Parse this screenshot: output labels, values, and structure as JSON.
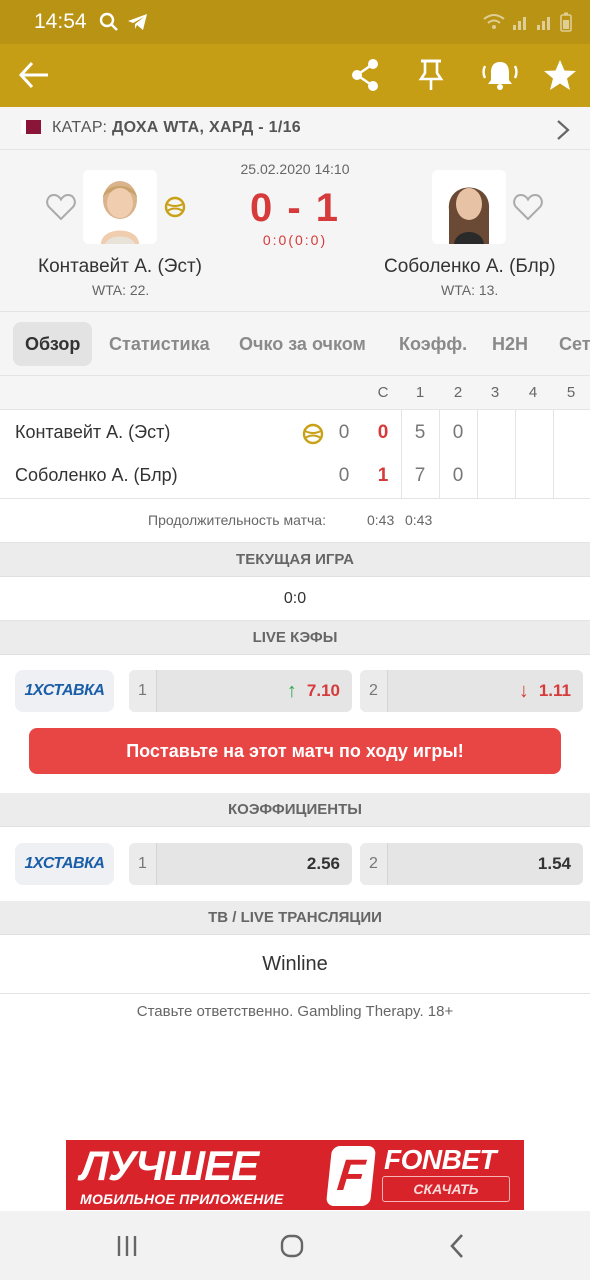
{
  "status_bar": {
    "time": "14:54"
  },
  "tournament": {
    "prefix": "КАТАР:",
    "name": "ДОХА WTA, ХАРД - 1/16"
  },
  "match": {
    "datetime": "25.02.2020 14:10",
    "score": "0 - 1",
    "subscore": "0:0(0:0)",
    "player1": {
      "name": "Контавейт А. (Эст)",
      "rank": "WTA: 22."
    },
    "player2": {
      "name": "Соболенко А. (Блр)",
      "rank": "WTA: 13."
    }
  },
  "tabs": [
    "Обзор",
    "Статистика",
    "Очко за очком",
    "Коэфф.",
    "H2H",
    "Сет"
  ],
  "sets": {
    "headers": [
      "С",
      "1",
      "2",
      "3",
      "4",
      "5"
    ],
    "rows": [
      {
        "name": "Контавейт А. (Эст)",
        "game": "0",
        "sets": "0",
        "s1": "5",
        "s2": "0"
      },
      {
        "name": "Соболенко А. (Блр)",
        "game": "0",
        "sets": "1",
        "s1": "7",
        "s2": "0"
      }
    ]
  },
  "duration": {
    "label": "Продолжительность матча:",
    "value1": "0:43",
    "value2": "0:43"
  },
  "current_game": {
    "title": "ТЕКУЩАЯ ИГРА",
    "value": "0:0"
  },
  "live_odds": {
    "title": "LIVE КЭФЫ",
    "bookmaker": "1ХСТАВКА",
    "odd1": {
      "num": "1",
      "value": "7.10",
      "trend": "up"
    },
    "odd2": {
      "num": "2",
      "value": "1.11",
      "trend": "down"
    }
  },
  "bet_button": "Поставьте на этот матч по ходу игры!",
  "odds": {
    "title": "КОЭФФИЦИЕНТЫ",
    "bookmaker": "1ХСТАВКА",
    "odd1": {
      "num": "1",
      "value": "2.56"
    },
    "odd2": {
      "num": "2",
      "value": "1.54"
    }
  },
  "tv": {
    "title": "ТВ / LIVE ТРАНСЛЯЦИИ",
    "value": "Winline"
  },
  "responsible": "Ставьте ответственно. Gambling Therapy. 18+",
  "banner": {
    "headline": "ЛУЧШЕЕ",
    "subline": "МОБИЛЬНОЕ ПРИЛОЖЕНИЕ",
    "brand": "FONBET",
    "button": "СКАЧАТЬ",
    "logo_letter": "F"
  },
  "colors": {
    "header": "#c59e16",
    "status_bar": "#b99314",
    "accent_red": "#d63a3a",
    "odds_up": "#2aa84a",
    "bookmaker_blue": "#1b5ea8"
  },
  "icons": [
    "back-arrow-icon",
    "share-icon",
    "pin-icon",
    "bell-icon",
    "star-icon",
    "heart-icon",
    "tennis-ball-icon",
    "chevron-right-icon"
  ]
}
